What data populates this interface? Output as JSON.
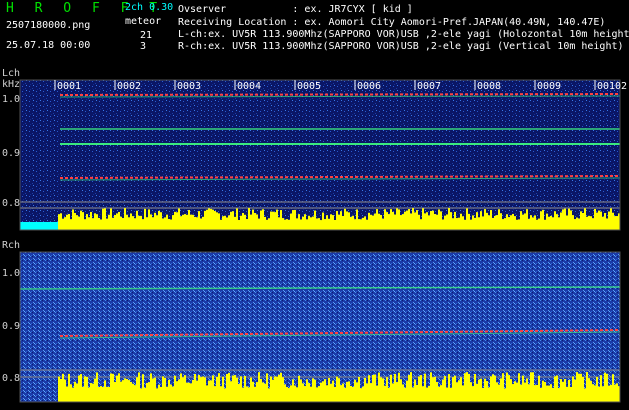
{
  "header": {
    "title": "H R O F F T",
    "filename": "2507180000.png",
    "datetime": "25.07.18 00:00",
    "mode": "2ch 0.30",
    "meteor_label": "meteor",
    "lch_count": "21",
    "rch_count": "3",
    "observer_line": "Ovserver           : ex. JR7CYX [ kid ]",
    "location_line": "Receiving Location : ex. Aomori City Aomori-Pref.JAPAN(40.49N, 140.47E)",
    "lch_line": "L-ch:ex. UV5R 113.900Mhz(SAPPORO VOR)USB ,2-ele yagi (Holozontal 10m height)",
    "rch_line": "R-ch:ex. UV5R 113.900Mhz(SAPPORO VOR)USB ,2-ele yagi (Vertical 10m height)"
  },
  "colors": {
    "title": "#00e000",
    "white": "#ffffff",
    "cyan": "#00ffff",
    "yellow": "#ffff00",
    "label_gray": "#d0d0d0",
    "grid": "#606060",
    "red_trace": "#ff4040",
    "green_trace": "#40ff80"
  },
  "lch_panel": {
    "label": "Lch",
    "unit": "kHz",
    "freq_ticks": [
      "1.0",
      "0.9",
      "0.8"
    ],
    "minute_markers": [
      "0001",
      "0002",
      "0003",
      "0004",
      "0005",
      "0006",
      "0007",
      "0008",
      "0009",
      "0010"
    ],
    "edge_marker": "2"
  },
  "rch_panel": {
    "label": "Rch",
    "freq_ticks": [
      "1.0",
      "0.9",
      "0.8"
    ]
  }
}
